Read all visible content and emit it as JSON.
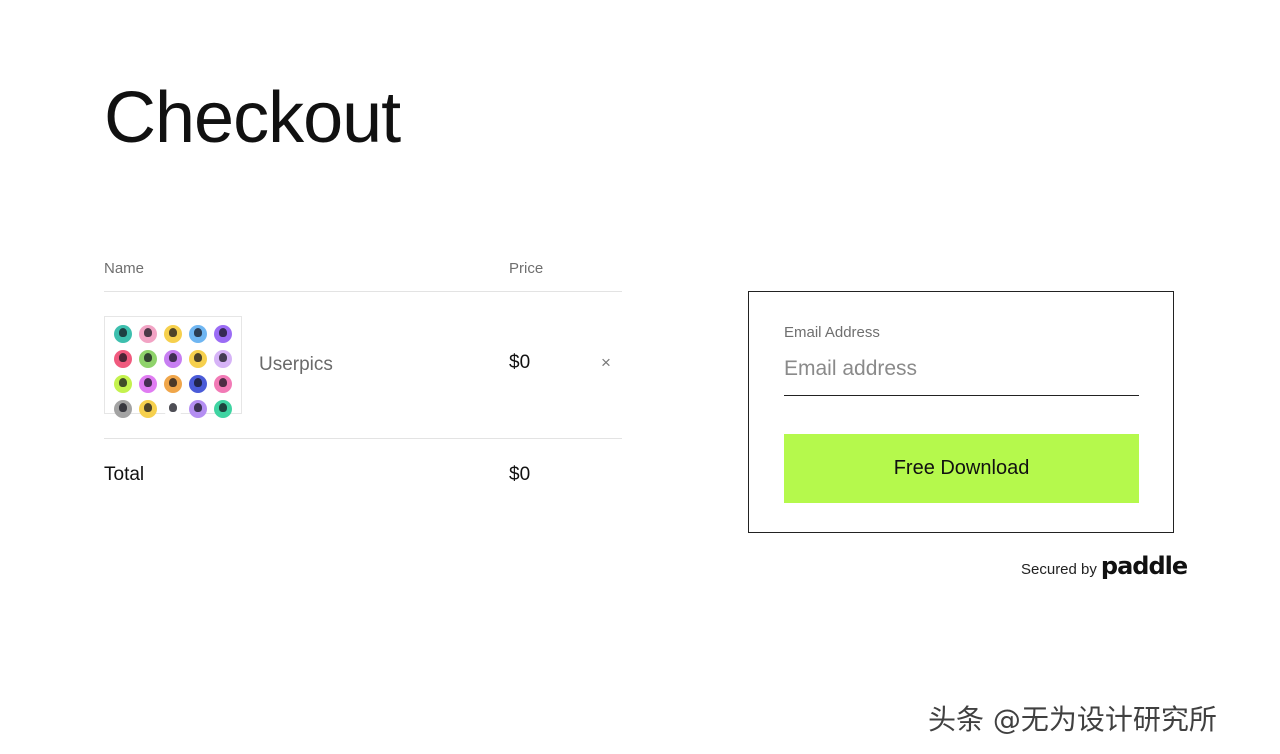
{
  "page": {
    "title": "Checkout"
  },
  "cart": {
    "headers": {
      "name": "Name",
      "price": "Price"
    },
    "items": [
      {
        "name": "Userpics",
        "price": "$0",
        "remove_icon": "close-icon",
        "remove_glyph": "×",
        "thumbnail_colors": [
          "#3dbfae",
          "#f2a3c4",
          "#f6d04d",
          "#6fb6f2",
          "#9b6cf5",
          "#f05a7e",
          "#8fd36b",
          "#c77ef2",
          "#f6d04d",
          "#d6b3f7",
          "#c4f24e",
          "#e07cf2",
          "#f0a64a",
          "#4a5bd8",
          "#f27ab6",
          "#a3a3a3",
          "#f6d04d",
          "#ffffff",
          "#b48ef2",
          "#3fd4a2"
        ]
      }
    ],
    "total": {
      "label": "Total",
      "value": "$0"
    }
  },
  "checkout": {
    "email_label": "Email Address",
    "email_value": "",
    "email_placeholder": "Email address",
    "button_label": "Free Download",
    "button_color": "#b5f94c"
  },
  "secured": {
    "text": "Secured by",
    "brand": "paddle"
  },
  "watermark": "头条 @无为设计研究所"
}
